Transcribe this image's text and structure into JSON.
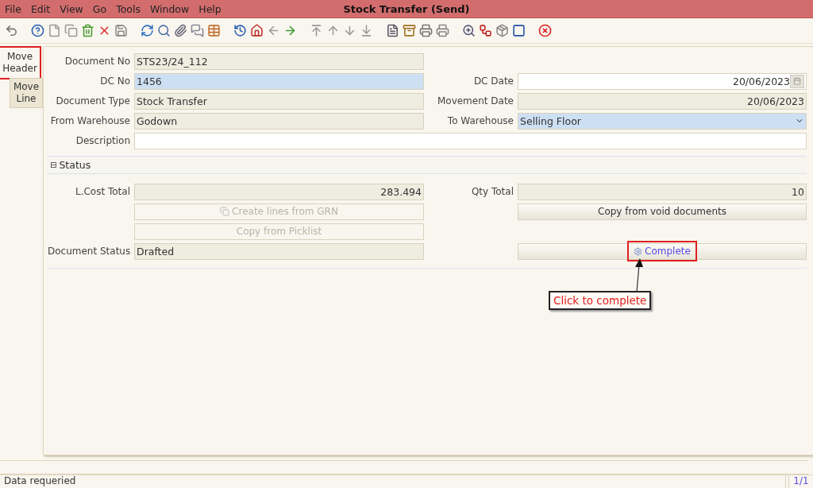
{
  "window": {
    "title": "Stock Transfer (Send)"
  },
  "menu": [
    "File",
    "Edit",
    "View",
    "Go",
    "Tools",
    "Window",
    "Help"
  ],
  "side_tabs": [
    {
      "label": "Move Header",
      "selected": true,
      "highlighted": true
    },
    {
      "label": "Move Line",
      "selected": false,
      "highlighted": false
    }
  ],
  "header_rows": [
    {
      "left": {
        "label": "Document No",
        "value": "STS23/24_112",
        "kind": "text",
        "readonly": true
      }
    },
    {
      "left": {
        "label": "DC No",
        "value": "1456",
        "kind": "text",
        "readonly": false,
        "mandatory": true
      },
      "right": {
        "label": "DC Date",
        "value": "20/06/2023",
        "kind": "date",
        "readonly": false,
        "mandatory": false
      }
    },
    {
      "left": {
        "label": "Document Type",
        "value": "Stock Transfer",
        "kind": "text",
        "readonly": true
      },
      "right": {
        "label": "Movement Date",
        "value": "20/06/2023",
        "kind": "amount",
        "readonly": true
      }
    },
    {
      "left": {
        "label": "From Warehouse",
        "value": "Godown",
        "kind": "text",
        "readonly": true
      },
      "right": {
        "label": "To Warehouse",
        "value": "Selling Floor",
        "kind": "select",
        "readonly": false,
        "mandatory": true
      }
    },
    {
      "full": {
        "label": "Description",
        "kind": "text",
        "readonly": false,
        "mandatory": false
      }
    }
  ],
  "status_section": {
    "title": "Status",
    "toggle": "⊟",
    "items": [
      {
        "kind": "amount",
        "label": "L.Cost Total",
        "value": "283.494",
        "readonly": true
      },
      {
        "kind": "amount",
        "label": "Qty Total",
        "value": "10",
        "readonly": true
      },
      {
        "kind": "copybutton",
        "label": "Create lines from GRN",
        "disabled": true,
        "highlighted": false
      },
      {
        "kind": "button",
        "label": "Copy from void documents",
        "disabled": false,
        "highlighted": false
      },
      {
        "kind": "button",
        "label": "Copy from Picklist",
        "disabled": true,
        "highlighted": false
      },
      {
        "kind": "empty"
      },
      {
        "kind": "text",
        "label": "Document Status",
        "value": "Drafted",
        "readonly": true
      },
      {
        "kind": "gearbutton",
        "label": "Complete",
        "disabled": false,
        "highlighted": true
      }
    ]
  },
  "callout": {
    "text": "Click to complete"
  },
  "status_bar": {
    "message": "Data requeried",
    "record": "1/1"
  }
}
